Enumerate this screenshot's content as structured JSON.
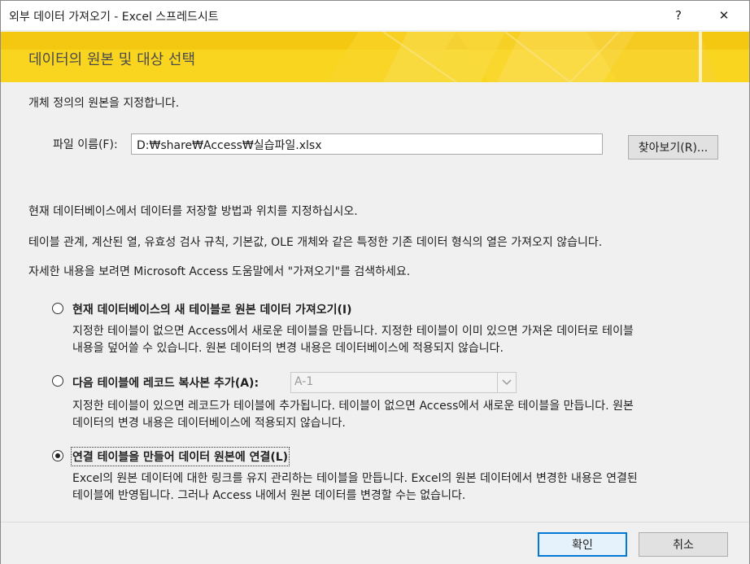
{
  "window": {
    "title": "외부 데이터 가져오기 - Excel 스프레드시트",
    "help_label": "?",
    "close_label": "✕"
  },
  "banner": {
    "title": "데이터의 원본 및 대상 선택"
  },
  "source": {
    "intro": "개체 정의의 원본을 지정합니다.",
    "file_label": "파일 이름(F):",
    "file_value": "D:₩share₩Access₩실습파일.xlsx",
    "browse_label": "찾아보기(R)..."
  },
  "info": {
    "line1": "현재 데이터베이스에서 데이터를 저장할 방법과 위치를 지정하십시오.",
    "line2": "테이블 관계, 계산된 열, 유효성 검사 규칙, 기본값, OLE 개체와 같은 특정한 기존 데이터 형식의 열은 가져오지 않습니다.",
    "line3": "자세한 내용을 보려면 Microsoft Access 도움말에서 \"가져오기\"를 검색하세요."
  },
  "options": {
    "import": {
      "label": "현재 데이터베이스의 새 테이블로 원본 데이터 가져오기(I)",
      "desc1": "지정한 테이블이 없으면 Access에서 새로운 테이블을 만듭니다. 지정한 테이블이 이미 있으면 가져온 데이터로 테이블",
      "desc2": "내용을 덮어쓸 수 있습니다. 원본 데이터의 변경 내용은 데이터베이스에 적용되지 않습니다.",
      "selected": false
    },
    "append": {
      "label": "다음 테이블에 레코드 복사본 추가(A):",
      "table_value": "A-1",
      "desc1": "지정한 테이블이 있으면 레코드가 테이블에 추가됩니다. 테이블이 없으면 Access에서 새로운 테이블을 만듭니다. 원본",
      "desc2": "데이터의 변경 내용은 데이터베이스에 적용되지 않습니다.",
      "selected": false
    },
    "link": {
      "label": "연결 테이블을 만들어 데이터 원본에 연결(L)",
      "desc1": "Excel의 원본 데이터에 대한 링크를 유지 관리하는 테이블을 만듭니다. Excel의 원본 데이터에서 변경한 내용은 연결된",
      "desc2": "테이블에 반영됩니다. 그러나 Access 내에서 원본 데이터를 변경할 수는 없습니다.",
      "selected": true
    }
  },
  "footer": {
    "ok_label": "확인",
    "cancel_label": "취소"
  },
  "colors": {
    "banner": "#f4c710",
    "banner_text": "#4b4b4b",
    "ok_border": "#0078d7"
  }
}
